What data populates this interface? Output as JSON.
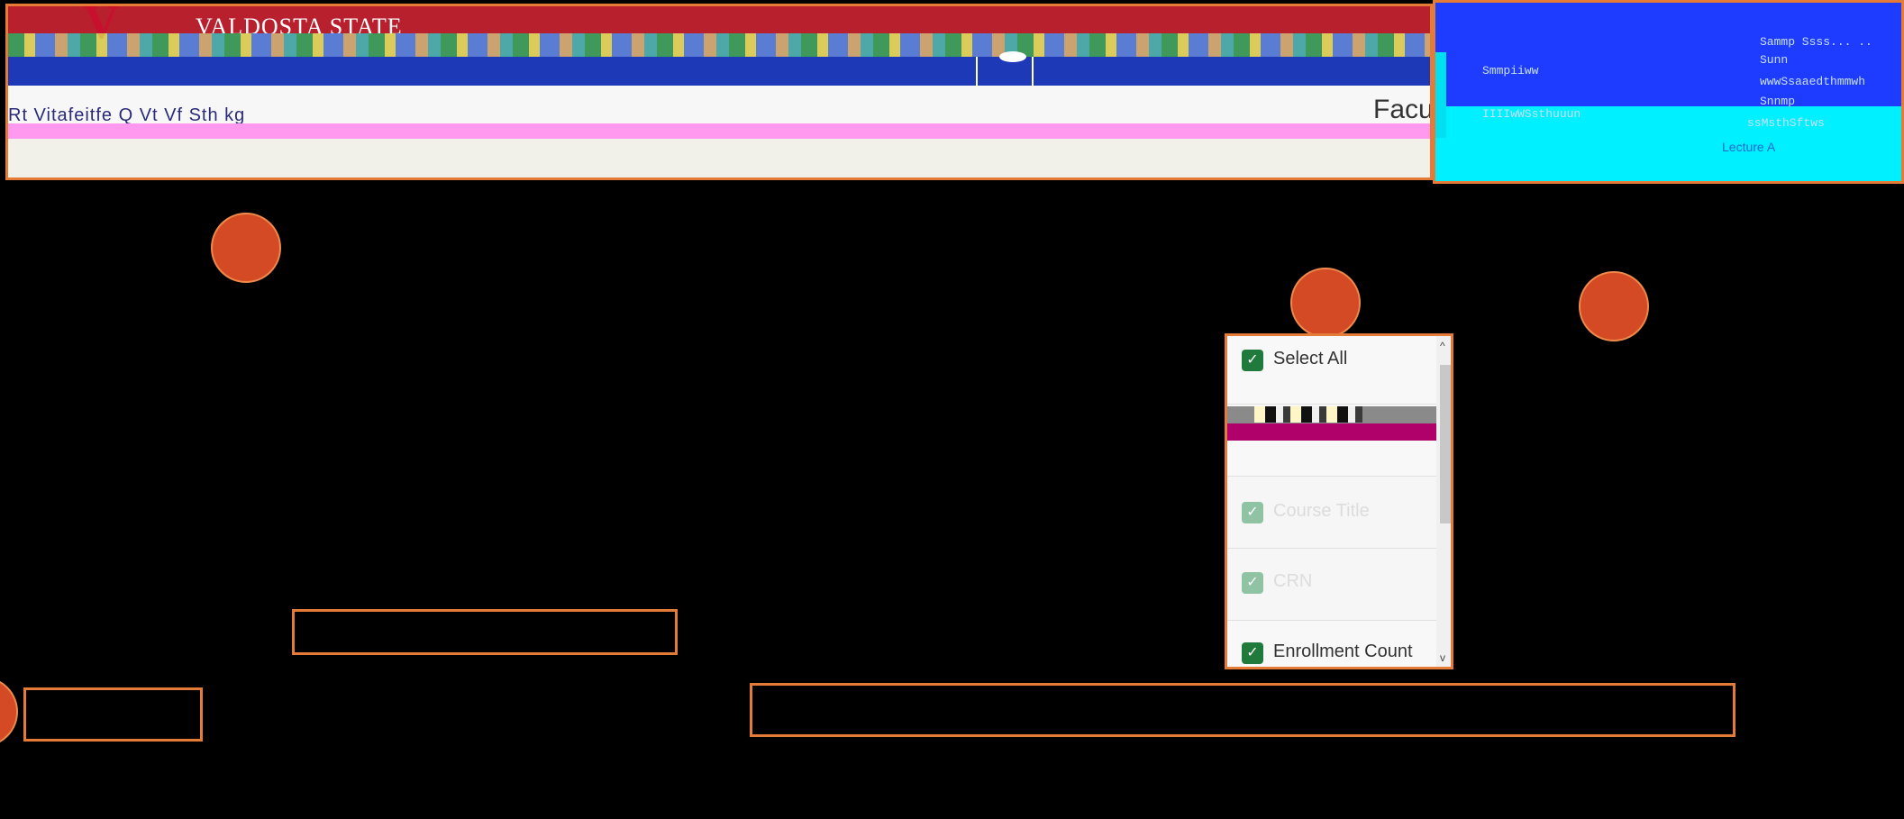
{
  "header": {
    "logo_mark": "V",
    "university_name": "VALDOSTA STATE",
    "nav_text": "Rt Vitafeitfe Q Vt Vf Sth kg",
    "page_title_partial": "Facu"
  },
  "side_panel": {
    "lines": [
      "Smmpiiww",
      "IIIIwWSsthuuun",
      "Sammp Ssss... ..",
      "Sunn",
      "wwwSsaaedthmmwh",
      "Snnmp",
      "ssMsthSftws"
    ],
    "lecture_label": "Lecture A"
  },
  "column_menu": {
    "items": [
      {
        "label": "Select All",
        "checked": true,
        "enabled": true
      },
      {
        "label": "Course Title",
        "checked": true,
        "enabled": false
      },
      {
        "label": "CRN",
        "checked": true,
        "enabled": false
      },
      {
        "label": "Enrollment Count",
        "checked": true,
        "enabled": true
      }
    ],
    "check_glyph": "✓",
    "scroll_up_glyph": "^",
    "scroll_down_glyph": "v"
  },
  "colors": {
    "accent_orange": "#e47b36",
    "marker_fill": "#d44a25",
    "check_green": "#1f7a3c",
    "header_red": "#b8202e",
    "nav_blue": "#1e39b8"
  }
}
